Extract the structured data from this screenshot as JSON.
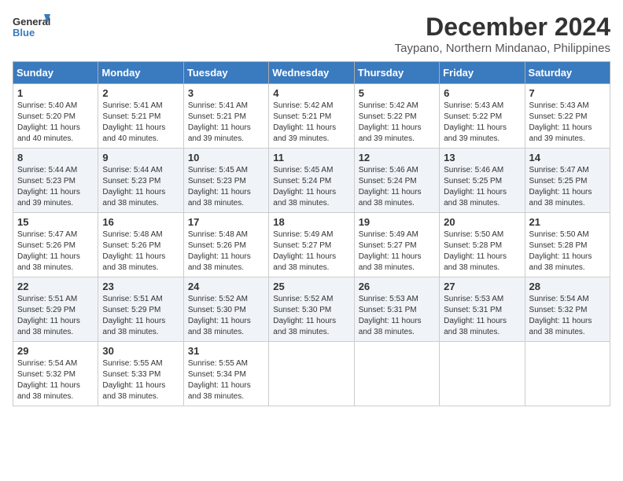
{
  "header": {
    "logo_line1": "General",
    "logo_line2": "Blue",
    "month": "December 2024",
    "location": "Taypano, Northern Mindanao, Philippines"
  },
  "days_of_week": [
    "Sunday",
    "Monday",
    "Tuesday",
    "Wednesday",
    "Thursday",
    "Friday",
    "Saturday"
  ],
  "weeks": [
    [
      {
        "day": "1",
        "sunrise": "5:40 AM",
        "sunset": "5:20 PM",
        "daylight": "11 hours and 40 minutes."
      },
      {
        "day": "2",
        "sunrise": "5:41 AM",
        "sunset": "5:21 PM",
        "daylight": "11 hours and 40 minutes."
      },
      {
        "day": "3",
        "sunrise": "5:41 AM",
        "sunset": "5:21 PM",
        "daylight": "11 hours and 39 minutes."
      },
      {
        "day": "4",
        "sunrise": "5:42 AM",
        "sunset": "5:21 PM",
        "daylight": "11 hours and 39 minutes."
      },
      {
        "day": "5",
        "sunrise": "5:42 AM",
        "sunset": "5:22 PM",
        "daylight": "11 hours and 39 minutes."
      },
      {
        "day": "6",
        "sunrise": "5:43 AM",
        "sunset": "5:22 PM",
        "daylight": "11 hours and 39 minutes."
      },
      {
        "day": "7",
        "sunrise": "5:43 AM",
        "sunset": "5:22 PM",
        "daylight": "11 hours and 39 minutes."
      }
    ],
    [
      {
        "day": "8",
        "sunrise": "5:44 AM",
        "sunset": "5:23 PM",
        "daylight": "11 hours and 39 minutes."
      },
      {
        "day": "9",
        "sunrise": "5:44 AM",
        "sunset": "5:23 PM",
        "daylight": "11 hours and 38 minutes."
      },
      {
        "day": "10",
        "sunrise": "5:45 AM",
        "sunset": "5:23 PM",
        "daylight": "11 hours and 38 minutes."
      },
      {
        "day": "11",
        "sunrise": "5:45 AM",
        "sunset": "5:24 PM",
        "daylight": "11 hours and 38 minutes."
      },
      {
        "day": "12",
        "sunrise": "5:46 AM",
        "sunset": "5:24 PM",
        "daylight": "11 hours and 38 minutes."
      },
      {
        "day": "13",
        "sunrise": "5:46 AM",
        "sunset": "5:25 PM",
        "daylight": "11 hours and 38 minutes."
      },
      {
        "day": "14",
        "sunrise": "5:47 AM",
        "sunset": "5:25 PM",
        "daylight": "11 hours and 38 minutes."
      }
    ],
    [
      {
        "day": "15",
        "sunrise": "5:47 AM",
        "sunset": "5:26 PM",
        "daylight": "11 hours and 38 minutes."
      },
      {
        "day": "16",
        "sunrise": "5:48 AM",
        "sunset": "5:26 PM",
        "daylight": "11 hours and 38 minutes."
      },
      {
        "day": "17",
        "sunrise": "5:48 AM",
        "sunset": "5:26 PM",
        "daylight": "11 hours and 38 minutes."
      },
      {
        "day": "18",
        "sunrise": "5:49 AM",
        "sunset": "5:27 PM",
        "daylight": "11 hours and 38 minutes."
      },
      {
        "day": "19",
        "sunrise": "5:49 AM",
        "sunset": "5:27 PM",
        "daylight": "11 hours and 38 minutes."
      },
      {
        "day": "20",
        "sunrise": "5:50 AM",
        "sunset": "5:28 PM",
        "daylight": "11 hours and 38 minutes."
      },
      {
        "day": "21",
        "sunrise": "5:50 AM",
        "sunset": "5:28 PM",
        "daylight": "11 hours and 38 minutes."
      }
    ],
    [
      {
        "day": "22",
        "sunrise": "5:51 AM",
        "sunset": "5:29 PM",
        "daylight": "11 hours and 38 minutes."
      },
      {
        "day": "23",
        "sunrise": "5:51 AM",
        "sunset": "5:29 PM",
        "daylight": "11 hours and 38 minutes."
      },
      {
        "day": "24",
        "sunrise": "5:52 AM",
        "sunset": "5:30 PM",
        "daylight": "11 hours and 38 minutes."
      },
      {
        "day": "25",
        "sunrise": "5:52 AM",
        "sunset": "5:30 PM",
        "daylight": "11 hours and 38 minutes."
      },
      {
        "day": "26",
        "sunrise": "5:53 AM",
        "sunset": "5:31 PM",
        "daylight": "11 hours and 38 minutes."
      },
      {
        "day": "27",
        "sunrise": "5:53 AM",
        "sunset": "5:31 PM",
        "daylight": "11 hours and 38 minutes."
      },
      {
        "day": "28",
        "sunrise": "5:54 AM",
        "sunset": "5:32 PM",
        "daylight": "11 hours and 38 minutes."
      }
    ],
    [
      {
        "day": "29",
        "sunrise": "5:54 AM",
        "sunset": "5:32 PM",
        "daylight": "11 hours and 38 minutes."
      },
      {
        "day": "30",
        "sunrise": "5:55 AM",
        "sunset": "5:33 PM",
        "daylight": "11 hours and 38 minutes."
      },
      {
        "day": "31",
        "sunrise": "5:55 AM",
        "sunset": "5:34 PM",
        "daylight": "11 hours and 38 minutes."
      },
      null,
      null,
      null,
      null
    ]
  ]
}
